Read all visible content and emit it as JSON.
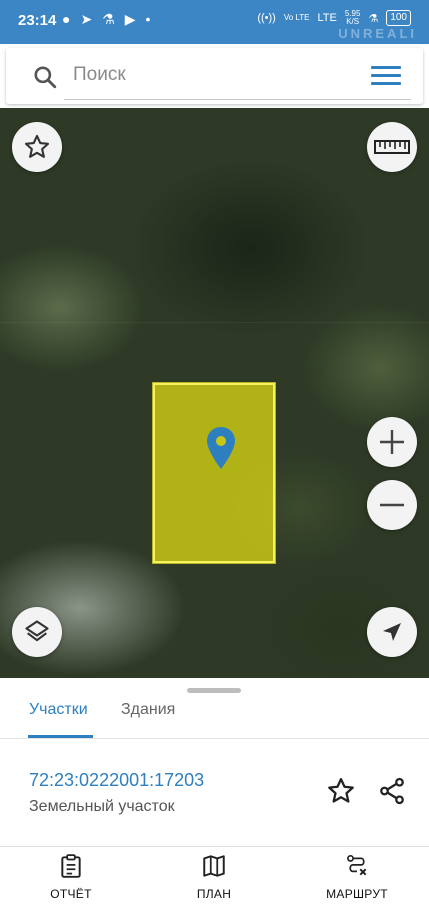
{
  "status_bar": {
    "time": "23:14",
    "volte": "Vo LTE",
    "lte": "LTE",
    "speed_value": "5.95",
    "speed_unit": "K/S",
    "battery": "100",
    "watermark": "UNREALI"
  },
  "search": {
    "placeholder": "Поиск"
  },
  "tabs": [
    {
      "label": "Участки",
      "active": true
    },
    {
      "label": "Здания",
      "active": false
    }
  ],
  "parcel": {
    "cadastral_number": "72:23:0222001:17203",
    "type": "Земельный участок"
  },
  "bottom_nav": {
    "report": "ОТЧЁТ",
    "plan": "ПЛАН",
    "route": "МАРШРУТ"
  },
  "colors": {
    "accent": "#2d7fc0",
    "status_bar": "#3d86c6",
    "parcel_fill": "#c8c814"
  }
}
